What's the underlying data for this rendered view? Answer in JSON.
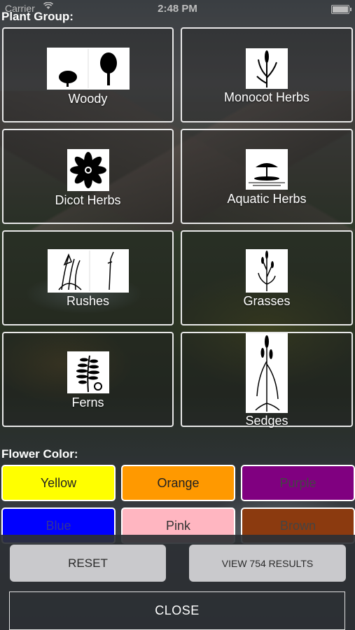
{
  "status_bar": {
    "carrier": "Carrier",
    "time": "2:48 PM",
    "battery_level": 1.0
  },
  "plant_group": {
    "title": "Plant Group:",
    "items": [
      {
        "label": "Woody",
        "icon": "woody-icon"
      },
      {
        "label": "Monocot Herbs",
        "icon": "monocot-icon"
      },
      {
        "label": "Dicot Herbs",
        "icon": "dicot-flower-icon"
      },
      {
        "label": "Aquatic Herbs",
        "icon": "aquatic-plant-icon"
      },
      {
        "label": "Rushes",
        "icon": "rushes-icon"
      },
      {
        "label": "Grasses",
        "icon": "grass-icon"
      },
      {
        "label": "Ferns",
        "icon": "fern-icon"
      },
      {
        "label": "Sedges",
        "icon": "sedge-icon"
      }
    ]
  },
  "flower_color": {
    "title": "Flower Color:",
    "items": [
      {
        "label": "Yellow",
        "bg": "#ffff00",
        "fg": "#222222"
      },
      {
        "label": "Orange",
        "bg": "#ff9900",
        "fg": "#222222"
      },
      {
        "label": "Purple",
        "bg": "#800080",
        "fg": "#444444"
      },
      {
        "label": "Blue",
        "bg": "#0000ff",
        "fg": "#333399"
      },
      {
        "label": "Pink",
        "bg": "#ffb6c1",
        "fg": "#333333"
      },
      {
        "label": "Brown",
        "bg": "#8b3a0f",
        "fg": "#444444"
      }
    ]
  },
  "actions": {
    "reset_label": "RESET",
    "view_results_label": "VIEW 754 RESULTS",
    "close_label": "CLOSE"
  }
}
